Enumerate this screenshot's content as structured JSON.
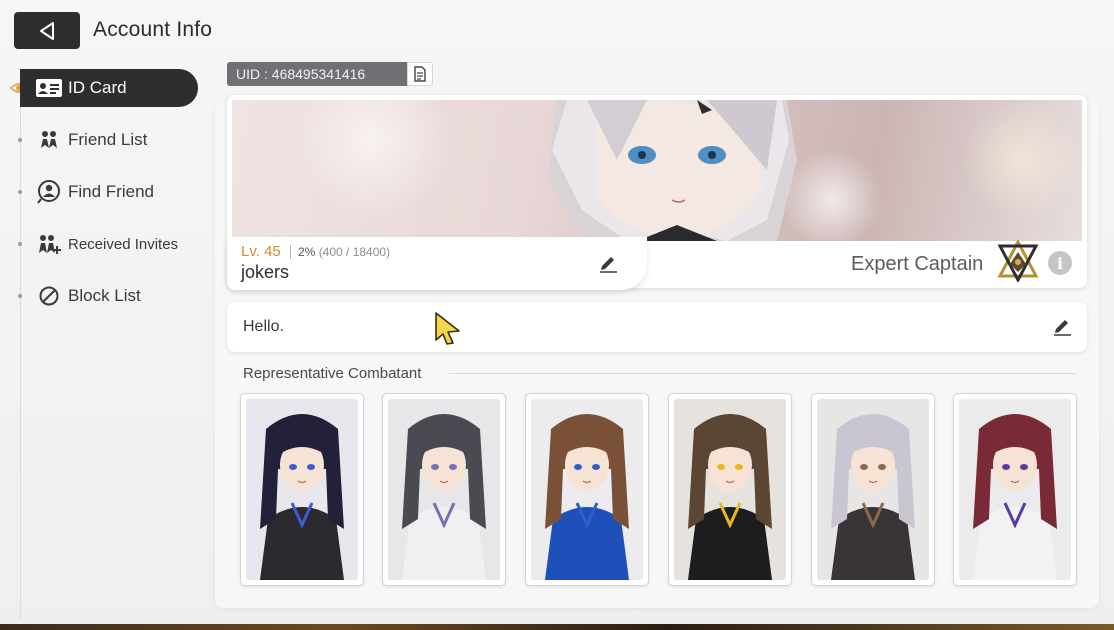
{
  "header": {
    "title": "Account Info",
    "back_icon": "back-arrow-icon"
  },
  "sidebar": {
    "items": [
      {
        "label": "ID Card",
        "icon": "id-card-icon",
        "active": true
      },
      {
        "label": "Friend List",
        "icon": "friends-icon",
        "active": false
      },
      {
        "label": "Find Friend",
        "icon": "find-friend-icon",
        "active": false
      },
      {
        "label": "Received Invites",
        "icon": "invites-icon",
        "active": false
      },
      {
        "label": "Block List",
        "icon": "block-icon",
        "active": false
      }
    ]
  },
  "uid": {
    "text": "UID : 468495341416",
    "copy_icon": "copy-icon"
  },
  "profile": {
    "level": "Lv. 45",
    "exp_percent": "2%",
    "exp_detail": "(400 / 18400)",
    "name": "jokers",
    "rank_title": "Expert Captain",
    "info_glyph": "i"
  },
  "bio": {
    "text": "Hello."
  },
  "combatants": {
    "label": "Representative Combatant",
    "cards": [
      {
        "hair": "#23203a",
        "accent": "#3e5bd6",
        "bg": "#e9e6ee",
        "outfit": "#2a2a2e"
      },
      {
        "hair": "#4a4a52",
        "accent": "#7a6fb0",
        "bg": "#e7e7ea",
        "outfit": "#f0f0f2"
      },
      {
        "hair": "#7a5036",
        "accent": "#2f5fc8",
        "bg": "#ecebee",
        "outfit": "#1f4fb8"
      },
      {
        "hair": "#5a4632",
        "accent": "#e8b81c",
        "bg": "#e6e3de",
        "outfit": "#1d1d1f"
      },
      {
        "hair": "#c9c6d2",
        "accent": "#8a6a4a",
        "bg": "#e8e6e4",
        "outfit": "#3a3438"
      },
      {
        "hair": "#7a2a36",
        "accent": "#5a3aa0",
        "bg": "#ebebee",
        "outfit": "#f2f2f4"
      }
    ]
  },
  "colors": {
    "accent_dark": "#2e2e30",
    "level_orange": "#d8882d",
    "cursor_yellow": "#f5d64a"
  }
}
